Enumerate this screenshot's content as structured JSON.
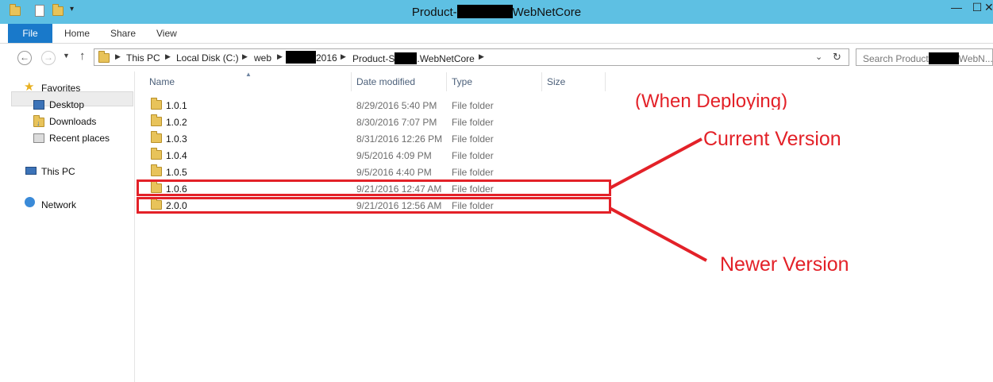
{
  "window": {
    "title_prefix": "Product-",
    "title_suffix": "WebNetCore"
  },
  "ribbon": {
    "tabs": [
      "File",
      "Home",
      "Share",
      "View"
    ]
  },
  "address": {
    "crumbs": [
      "This PC",
      "Local Disk (C:)",
      "web",
      "2016",
      "Product-S",
      ".WebNetCore"
    ],
    "search_placeholder_prefix": "Search Product",
    "search_placeholder_suffix": "WebN..."
  },
  "navpane": {
    "favorites": "Favorites",
    "desktop": "Desktop",
    "downloads": "Downloads",
    "recent": "Recent places",
    "thispc": "This PC",
    "network": "Network"
  },
  "columns": [
    "Name",
    "Date modified",
    "Type",
    "Size"
  ],
  "files": [
    {
      "name": "1.0.1",
      "date": "8/29/2016 5:40 PM",
      "type": "File folder"
    },
    {
      "name": "1.0.2",
      "date": "8/30/2016 7:07 PM",
      "type": "File folder"
    },
    {
      "name": "1.0.3",
      "date": "8/31/2016 12:26 PM",
      "type": "File folder"
    },
    {
      "name": "1.0.4",
      "date": "9/5/2016 4:09 PM",
      "type": "File folder"
    },
    {
      "name": "1.0.5",
      "date": "9/5/2016 4:40 PM",
      "type": "File folder"
    },
    {
      "name": "1.0.6",
      "date": "9/21/2016 12:47 AM",
      "type": "File folder"
    },
    {
      "name": "2.0.0",
      "date": "9/21/2016 12:56 AM",
      "type": "File folder"
    }
  ],
  "annotations": {
    "deploying": "(When Deploying)",
    "current": "Current Version",
    "newer": "Newer Version",
    "color": "#e32128"
  }
}
